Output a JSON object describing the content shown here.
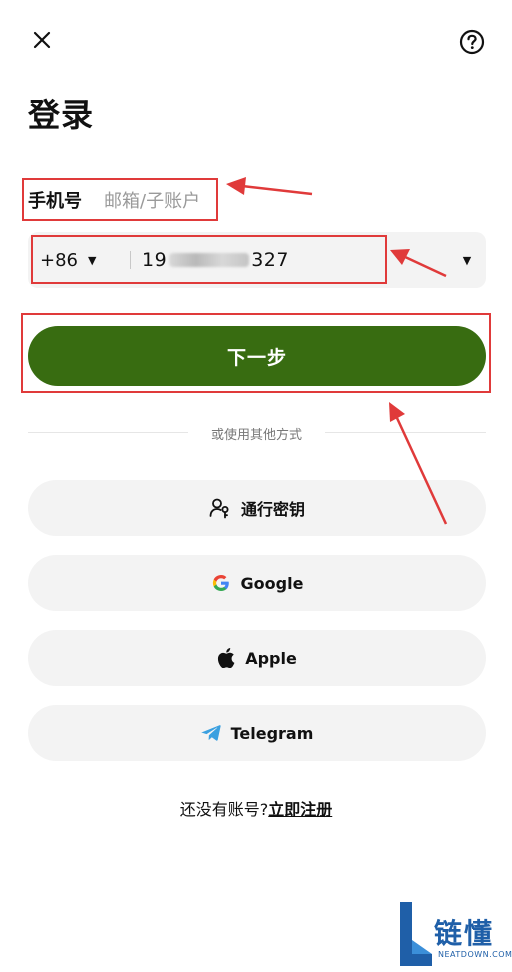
{
  "header": {
    "close_icon": "close-icon",
    "help_icon": "help-circle-icon"
  },
  "title": "登录",
  "tabs": [
    {
      "label": "手机号",
      "active": true
    },
    {
      "label": "邮箱/子账户",
      "active": false
    }
  ],
  "phone": {
    "country_code": "+86",
    "value_prefix": "19",
    "value_suffix": "327"
  },
  "next_label": "下一步",
  "divider_text": "或使用其他方式",
  "alt_methods": [
    {
      "label": "通行密钥",
      "icon": "passkey-icon"
    },
    {
      "label": "Google",
      "icon": "google-icon"
    },
    {
      "label": "Apple",
      "icon": "apple-icon"
    },
    {
      "label": "Telegram",
      "icon": "telegram-icon"
    }
  ],
  "signup": {
    "prompt": "还没有账号?",
    "link": "立即注册"
  },
  "watermark": {
    "text": "链懂",
    "sub": "NEATDOWN.COM"
  },
  "colors": {
    "primary": "#386c11",
    "field_bg": "#f3f3f3",
    "annotation": "#e03a3a",
    "watermark": "#1f5fa8"
  }
}
